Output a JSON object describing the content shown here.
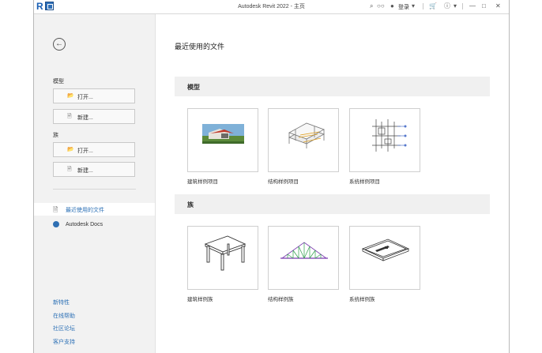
{
  "titlebar": {
    "title": "Autodesk Revit 2022 - 主页",
    "app_logo": "R",
    "signin_label": "登录"
  },
  "sidebar": {
    "back_icon": "←",
    "models_heading": "模型",
    "models_open": "打开...",
    "models_new": "新建...",
    "families_heading": "族",
    "families_open": "打开...",
    "families_new": "新建...",
    "nav_recent": "最近使用的文件",
    "nav_docs": "Autodesk Docs",
    "footer_links": [
      "新特性",
      "在线帮助",
      "社区论坛",
      "客户支持"
    ]
  },
  "main": {
    "title": "最近使用的文件",
    "models_section": "模型",
    "model_cards": [
      "建筑样例项目",
      "结构样例项目",
      "系统样例项目"
    ],
    "families_section": "族",
    "family_cards": [
      "建筑样例族",
      "结构样例族",
      "系统样例族"
    ]
  },
  "colors": {
    "accent": "#2a6fb5",
    "sidebar_bg": "#f2f2f2",
    "section_bg": "#f0f0f0"
  },
  "icons": [
    "revit-logo-icon",
    "quick-access-icon",
    "search-icon",
    "binoculars-icon",
    "user-icon",
    "cart-icon",
    "help-icon",
    "minimize-icon",
    "maximize-icon",
    "close-icon",
    "folder-open-icon",
    "new-file-icon",
    "recent-files-icon",
    "globe-icon"
  ]
}
